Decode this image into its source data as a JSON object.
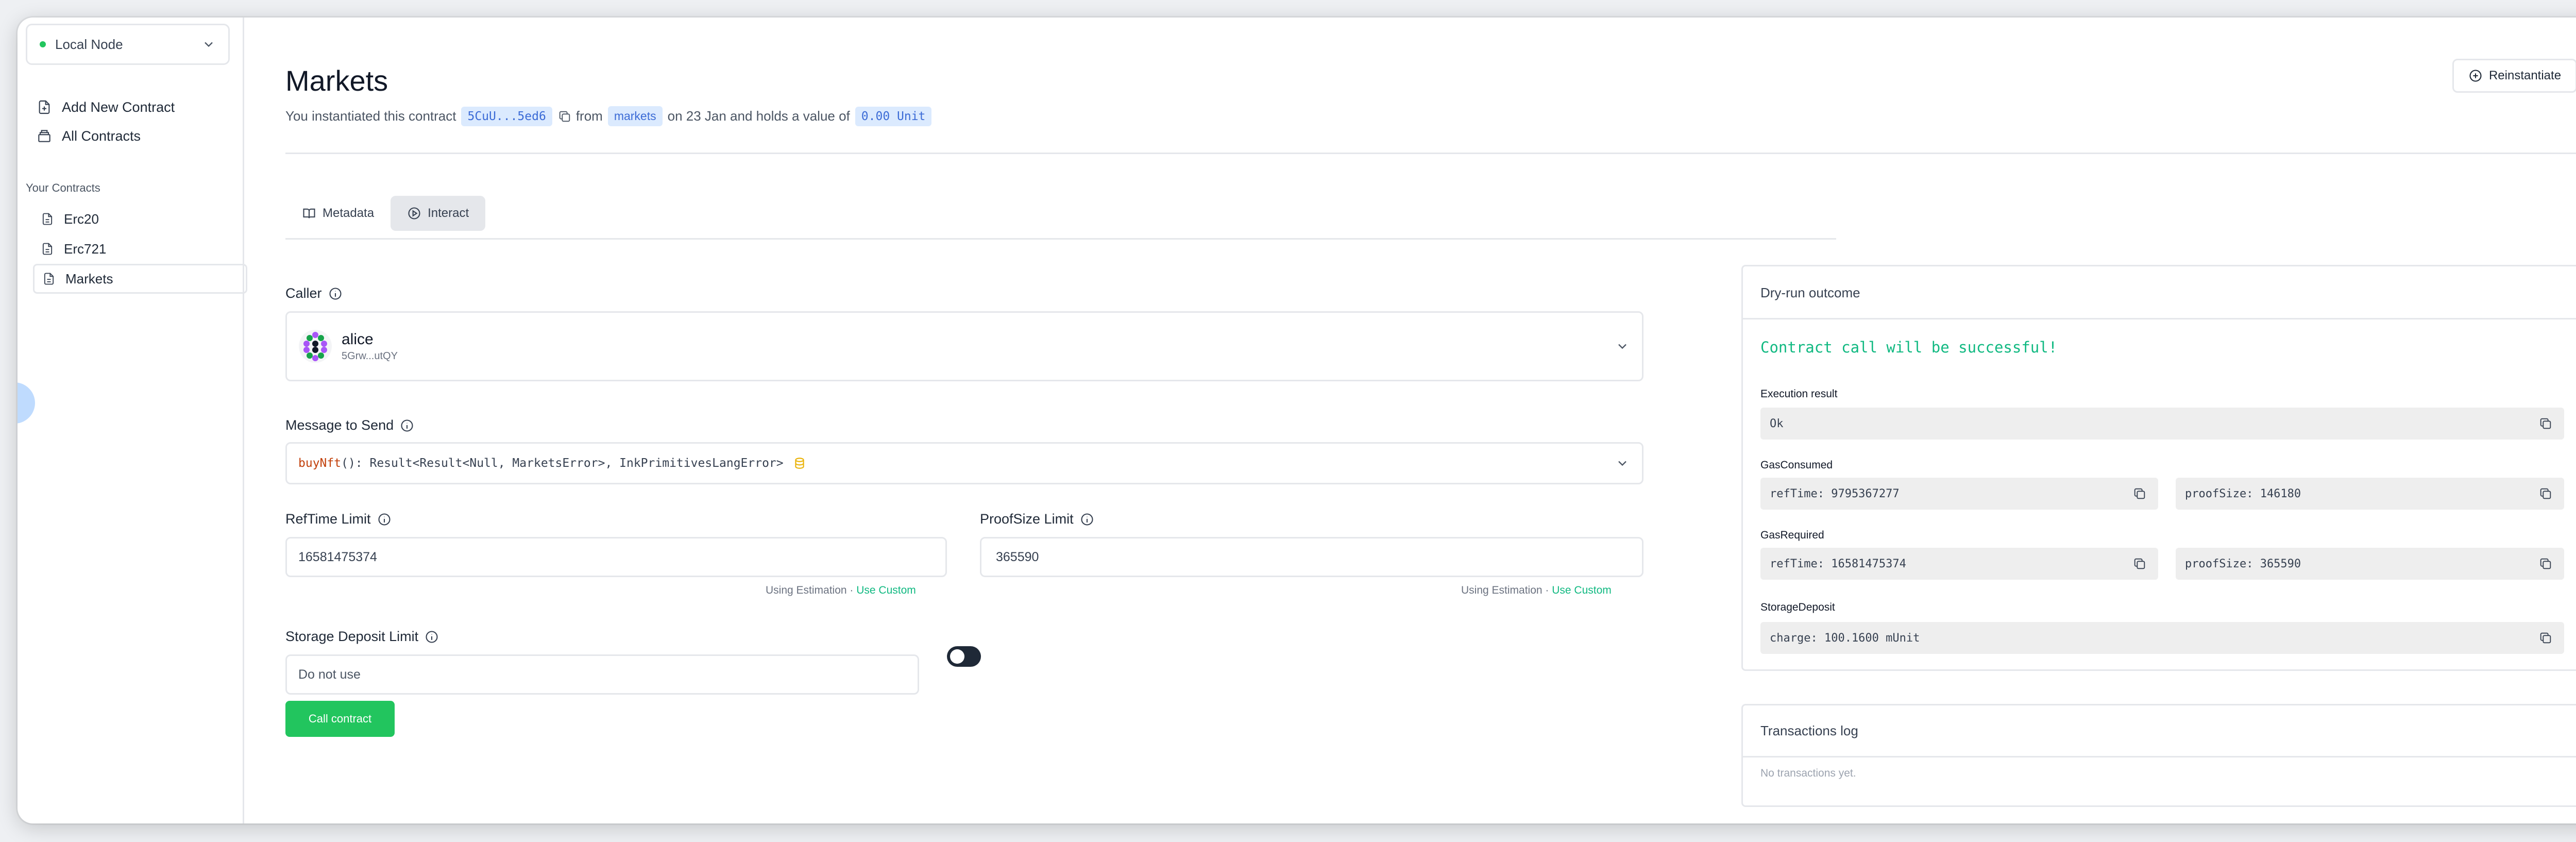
{
  "sidebar": {
    "node": "Local Node",
    "add_contract": "Add New Contract",
    "all_contracts": "All Contracts",
    "your_contracts_heading": "Your Contracts",
    "contracts": [
      "Erc20",
      "Erc721",
      "Markets"
    ],
    "active_contract": "Markets"
  },
  "header": {
    "title": "Markets",
    "sub_prefix": "You instantiated this contract",
    "address": "5CuU...5ed6",
    "sub_from": "from",
    "code_name": "markets",
    "sub_mid": "on 23 Jan and holds a value of",
    "value": "0.00 Unit",
    "reinstantiate": "Reinstantiate"
  },
  "tabs": [
    {
      "label": "Metadata",
      "icon": "book-icon"
    },
    {
      "label": "Interact",
      "icon": "play-circle-icon"
    }
  ],
  "active_tab": "Interact",
  "form": {
    "caller_label": "Caller",
    "caller_name": "alice",
    "caller_address": "5Grw...utQY",
    "message_label": "Message to Send",
    "message_fn": "buyNft",
    "message_sig": "(): Result<Result<Null, MarketsError>, InkPrimitivesLangError>",
    "reftime_label": "RefTime Limit",
    "reftime_value": "16581475374",
    "proofsize_label": "ProofSize Limit",
    "proofsize_value": "365590",
    "using_estimation": "Using Estimation",
    "separator": "·",
    "use_custom": "Use Custom",
    "storage_label": "Storage Deposit Limit",
    "storage_placeholder": "Do not use",
    "call_button": "Call contract"
  },
  "dry_run": {
    "title": "Dry-run outcome",
    "success_message": "Contract call will be successful!",
    "execution_label": "Execution result",
    "execution_value": "Ok",
    "gas_consumed_label": "GasConsumed",
    "gas_consumed_reftime": "refTime: 9795367277",
    "gas_consumed_proofsize": "proofSize: 146180",
    "gas_required_label": "GasRequired",
    "gas_required_reftime": "refTime: 16581475374",
    "gas_required_proofsize": "proofSize: 365590",
    "storage_label": "StorageDeposit",
    "storage_value": "charge: 100.1600 mUnit"
  },
  "tx_log": {
    "title": "Transactions log",
    "empty": "No transactions yet."
  },
  "colors": {
    "accent_green": "#22c55e",
    "pill_bg": "#dbeafe",
    "pill_text": "#3b6bd6",
    "success_text": "#10b981"
  }
}
